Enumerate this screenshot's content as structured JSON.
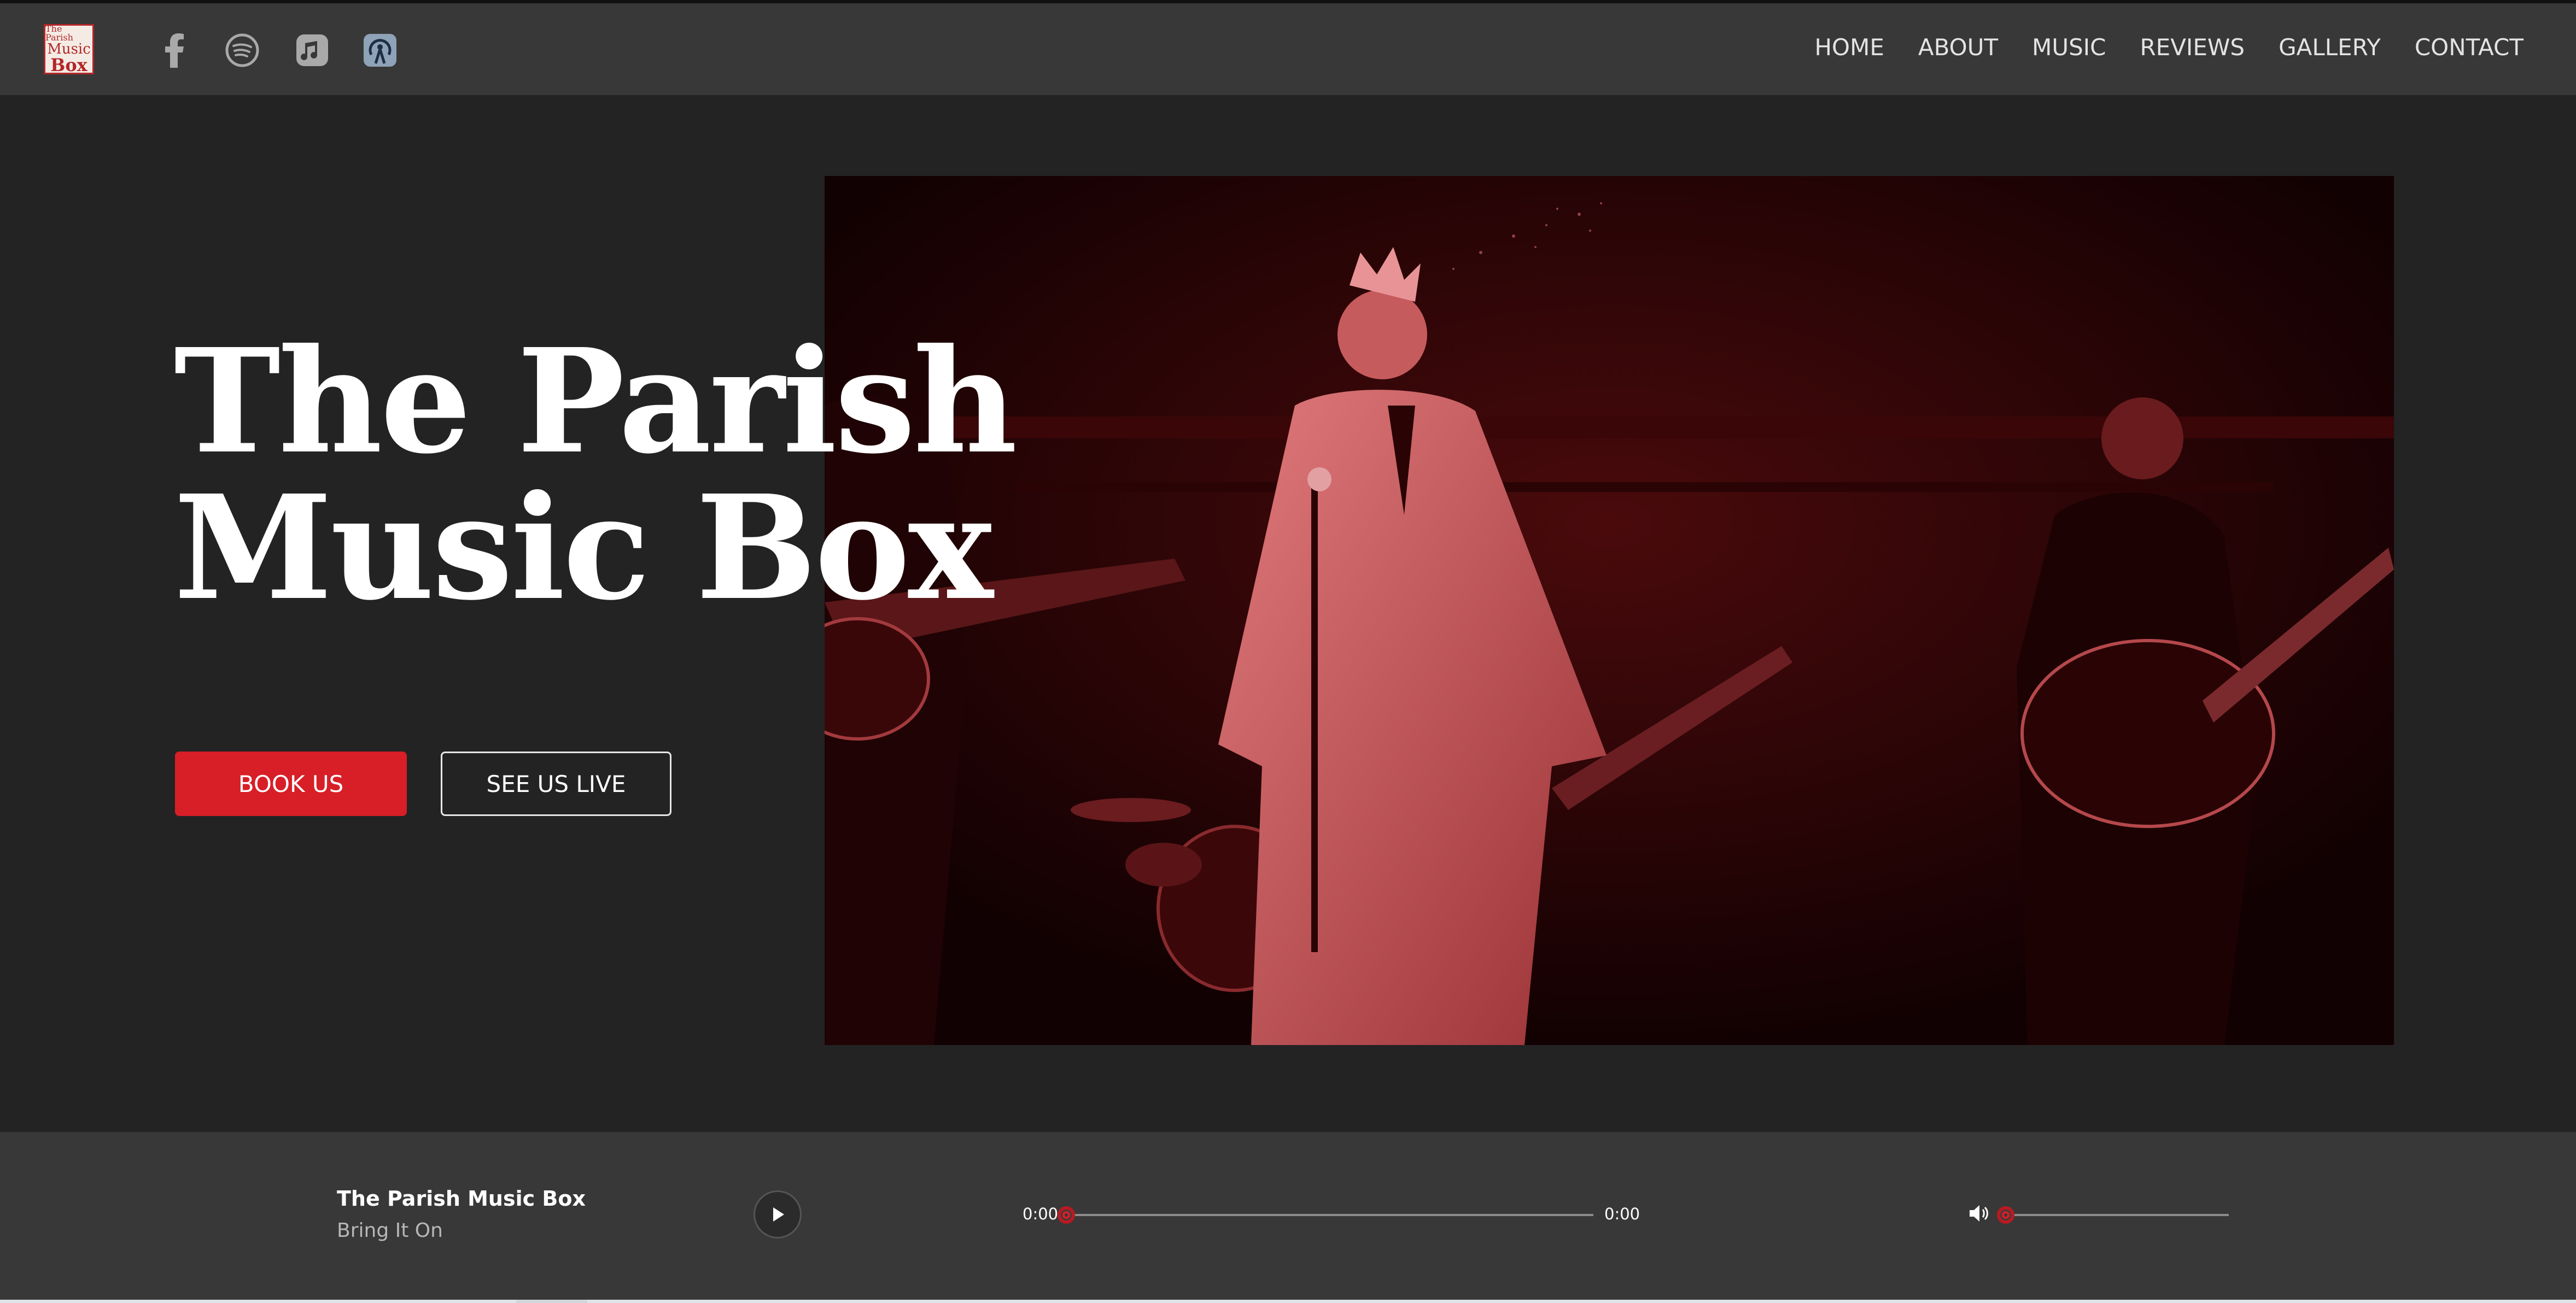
{
  "header": {
    "logo_text": [
      "The Parish",
      "Music",
      "Box"
    ],
    "social_icons": [
      "facebook-icon",
      "spotify-icon",
      "apple-music-icon",
      "podcast-icon"
    ],
    "nav": [
      "HOME",
      "ABOUT",
      "MUSIC",
      "REVIEWS",
      "GALLERY",
      "CONTACT"
    ]
  },
  "hero": {
    "title_line1": "The Parish",
    "title_line2": "Music Box",
    "book_button": "BOOK US",
    "live_button": "SEE US LIVE",
    "image_description_colors": {
      "tint": "#c0474b",
      "shadow": "#150203"
    }
  },
  "player": {
    "track_title": "The Parish Music Box",
    "track_subtitle": "Bring It On",
    "current_time": "0:00",
    "duration": "0:00",
    "progress": 0,
    "volume": 0
  },
  "colors": {
    "accent": "#d81e27",
    "background": "#232323",
    "header": "#383838",
    "text": "#ffffff"
  }
}
